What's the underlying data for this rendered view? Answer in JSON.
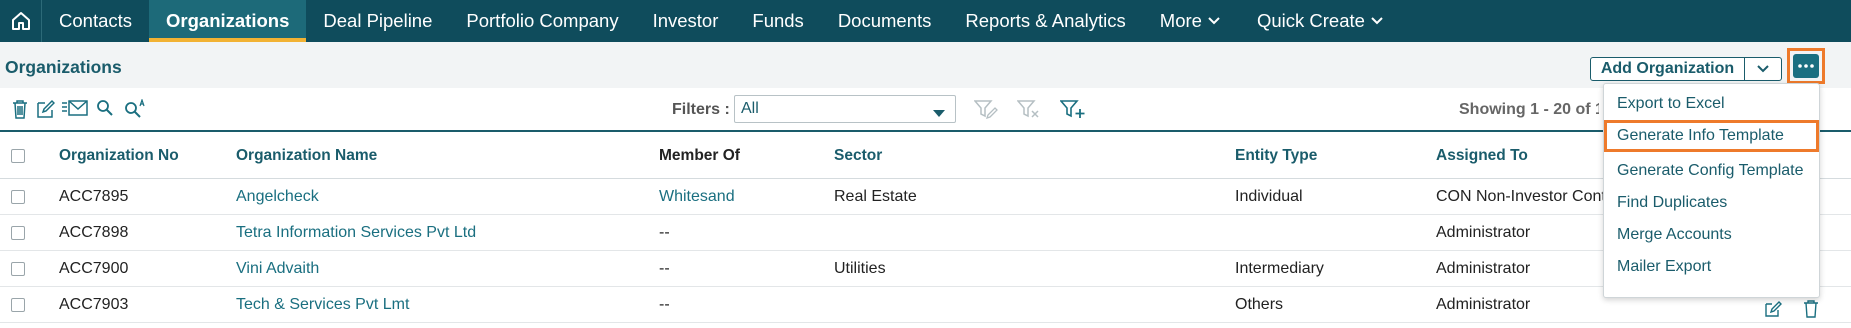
{
  "nav": {
    "items": [
      {
        "label": "Contacts"
      },
      {
        "label": "Organizations"
      },
      {
        "label": "Deal Pipeline"
      },
      {
        "label": "Portfolio Company"
      },
      {
        "label": "Investor"
      },
      {
        "label": "Funds"
      },
      {
        "label": "Documents"
      },
      {
        "label": "Reports & Analytics"
      },
      {
        "label": "More"
      },
      {
        "label": "Quick Create"
      }
    ],
    "active": "Organizations"
  },
  "header": {
    "title": "Organizations",
    "add_button": "Add Organization"
  },
  "toolbar": {
    "filters_label": "Filters :",
    "filter_value": "All",
    "showing": "Showing 1 - 20 of 1"
  },
  "table": {
    "columns": [
      "Organization No",
      "Organization Name",
      "Member Of",
      "Sector",
      "Entity Type",
      "Assigned To"
    ],
    "rows": [
      {
        "no": "ACC7895",
        "name": "Angelcheck",
        "member_of": "Whitesand",
        "sector": "Real Estate",
        "entity_type": "Individual",
        "assigned_to": "CON Non-Investor Cont"
      },
      {
        "no": "ACC7898",
        "name": "Tetra Information Services Pvt Ltd",
        "member_of": "--",
        "sector": "",
        "entity_type": "",
        "assigned_to": "Administrator"
      },
      {
        "no": "ACC7900",
        "name": "Vini Advaith",
        "member_of": "--",
        "sector": "Utilities",
        "entity_type": "Intermediary",
        "assigned_to": "Administrator"
      },
      {
        "no": "ACC7903",
        "name": "Tech & Services Pvt Lmt",
        "member_of": "--",
        "sector": "",
        "entity_type": "Others",
        "assigned_to": "Administrator"
      }
    ]
  },
  "more_menu": {
    "items": [
      {
        "label": "Export to Excel"
      },
      {
        "label": "Generate Info Template"
      },
      {
        "label": "Generate Config Template"
      },
      {
        "label": "Find Duplicates"
      },
      {
        "label": "Merge Accounts"
      },
      {
        "label": "Mailer Export"
      }
    ],
    "highlighted": "Generate Info Template"
  },
  "colors": {
    "nav_bg": "#0f4c5c",
    "accent": "#1a5c6b",
    "highlight": "#ee7a2b",
    "active_underline": "#f2b233"
  }
}
